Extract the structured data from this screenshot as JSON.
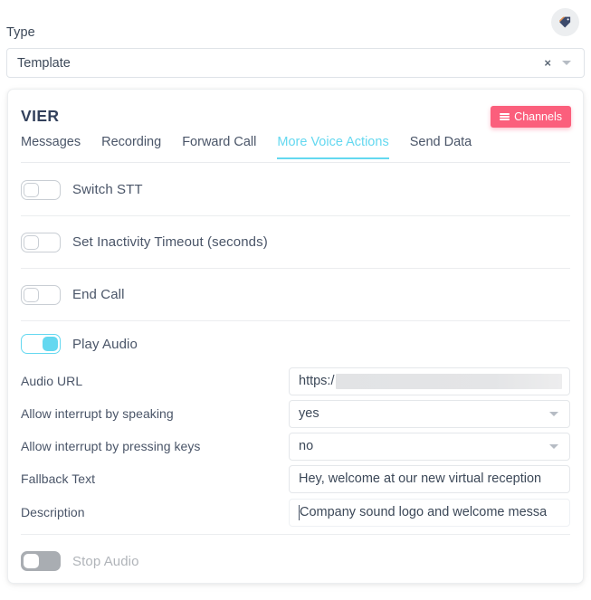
{
  "top": {
    "tag_button_icon": "tag-icon",
    "type_label": "Type",
    "type_value": "Template",
    "clear_icon": "×",
    "dropdown_icon": "chevron-down-icon"
  },
  "card": {
    "title": "VIER",
    "channels_button": "Channels",
    "channels_icon": "hamburger-menu-icon",
    "tabs": [
      {
        "label": "Messages",
        "active": false
      },
      {
        "label": "Recording",
        "active": false
      },
      {
        "label": "Forward Call",
        "active": false
      },
      {
        "label": "More Voice Actions",
        "active": true
      },
      {
        "label": "Send Data",
        "active": false
      }
    ],
    "toggles": [
      {
        "label": "Switch STT",
        "state": "off"
      },
      {
        "label": "Set Inactivity Timeout (seconds)",
        "state": "off"
      },
      {
        "label": "End Call",
        "state": "off"
      },
      {
        "label": "Play Audio",
        "state": "on"
      },
      {
        "label": "Stop Audio",
        "state": "disabled"
      }
    ],
    "fields": [
      {
        "label": "Audio URL",
        "type": "text",
        "value": "https:/",
        "redacted": true
      },
      {
        "label": "Allow interrupt by speaking",
        "type": "select",
        "value": "yes"
      },
      {
        "label": "Allow interrupt by pressing keys",
        "type": "select",
        "value": "no"
      },
      {
        "label": "Fallback Text",
        "type": "text",
        "value": "Hey, welcome at our new virtual reception "
      },
      {
        "label": "Description",
        "type": "text",
        "value": "Company sound logo and welcome messa",
        "focused": true
      }
    ]
  },
  "colors": {
    "accent_cyan": "#64d8f0",
    "channels_pink": "#fb5f7c",
    "text_dark": "#3c4858",
    "border_light": "#ebedef"
  }
}
